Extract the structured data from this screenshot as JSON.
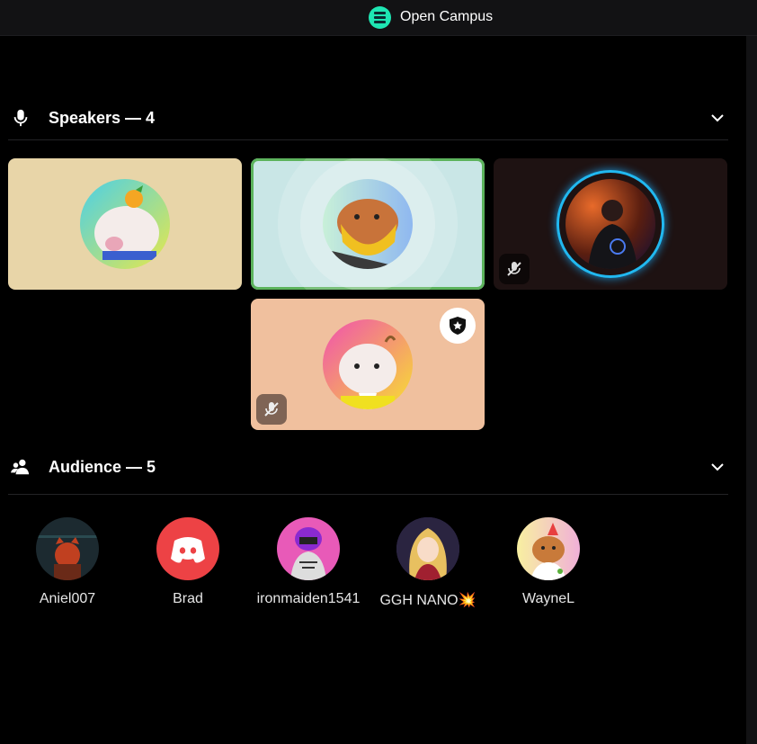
{
  "header": {
    "server_name": "Open Campus"
  },
  "speakers": {
    "title": "Speakers — 4",
    "tiles": [
      {
        "name": "speaker-1",
        "muted": false,
        "bg": "#e8d5a8"
      },
      {
        "name": "speaker-2",
        "muted": false,
        "bg": "#c9e6e6",
        "speaking": true
      },
      {
        "name": "speaker-3",
        "muted": true,
        "bg": "#1e1212"
      },
      {
        "name": "speaker-4",
        "muted": true,
        "bg": "#f0c09e",
        "moderator": true
      }
    ]
  },
  "audience": {
    "title": "Audience — 5",
    "members": [
      {
        "name": "Aniel007"
      },
      {
        "name": "Brad"
      },
      {
        "name": "ironmaiden1541"
      },
      {
        "name": "GGH NANO💥"
      },
      {
        "name": "WayneL"
      }
    ]
  },
  "colors": {
    "accent_speaking": "#5cb35c",
    "discord_red": "#ed4245",
    "server_badge": "#1ee6b3"
  }
}
